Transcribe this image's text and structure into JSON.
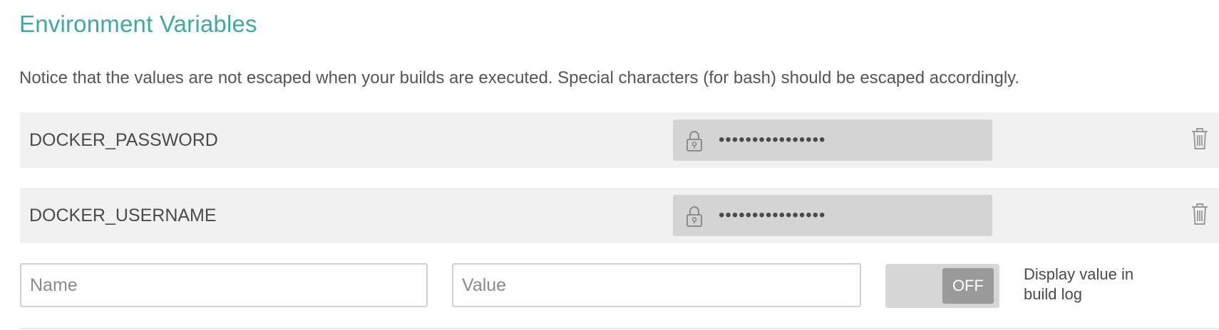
{
  "section": {
    "title": "Environment Variables",
    "notice": "Notice that the values are not escaped when your builds are executed. Special characters (for bash) should be escaped accordingly."
  },
  "variables": [
    {
      "name": "DOCKER_PASSWORD",
      "value_masked": "••••••••••••••••",
      "lock_icon": "lock-icon",
      "delete_icon": "trash-icon"
    },
    {
      "name": "DOCKER_USERNAME",
      "value_masked": "••••••••••••••••",
      "lock_icon": "lock-icon",
      "delete_icon": "trash-icon"
    }
  ],
  "new_variable": {
    "name_placeholder": "Name",
    "name_value": "",
    "value_placeholder": "Value",
    "value_value": "",
    "display_toggle_state": "OFF",
    "display_toggle_caption": "Display value in build log"
  },
  "colors": {
    "title": "#3ea8a6",
    "row_background": "#f1f1f1",
    "masked_value_background": "#d4d4d4",
    "toggle_knob": "#9a9a9a"
  }
}
